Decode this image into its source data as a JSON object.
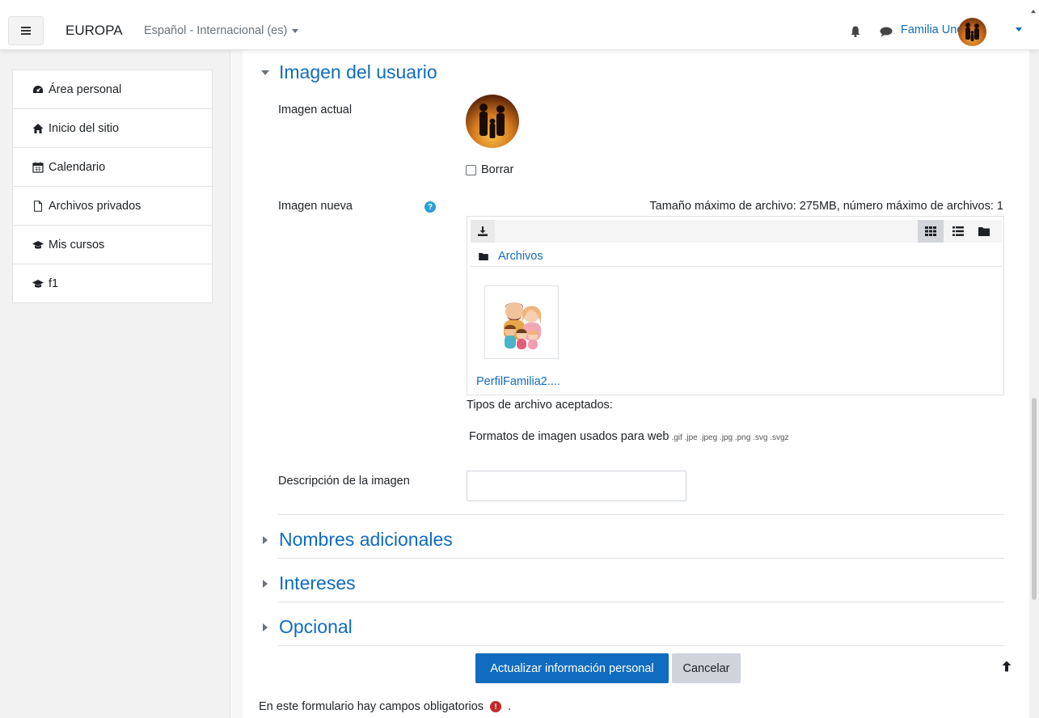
{
  "navbar": {
    "site_name": "EUROPA",
    "language": "Español - Internacional (es)",
    "user_name": "Familia Uno",
    "icons": [
      "hamburger-icon",
      "bell-icon",
      "chat-icon",
      "chevron-down-icon"
    ]
  },
  "sidebar": {
    "items": [
      {
        "label": "Área personal",
        "icon": "dashboard-icon"
      },
      {
        "label": "Inicio del sitio",
        "icon": "home-icon"
      },
      {
        "label": "Calendario",
        "icon": "calendar-icon"
      },
      {
        "label": "Archivos privados",
        "icon": "file-icon"
      },
      {
        "label": "Mis cursos",
        "icon": "graduation-cap-icon"
      },
      {
        "label": "f1",
        "icon": "graduation-cap-icon"
      }
    ]
  },
  "section_user_image": {
    "title": "Imagen del usuario",
    "current_image_label": "Imagen actual",
    "delete_label": "Borrar",
    "new_image_label": "Imagen nueva",
    "max_size_text": "Tamaño máximo de archivo: 275MB, número máximo de archivos: 1",
    "folder_label": "Archivos",
    "file_name": "PerfilFamilia2....",
    "accepted_types_label": "Tipos de archivo aceptados:",
    "formats_label": "Formatos de imagen usados para web",
    "formats_ext": ".gif .jpe .jpeg .jpg .png .svg .svgz",
    "description_label": "Descripción de la imagen",
    "description_value": ""
  },
  "collapsed_sections": [
    {
      "title": "Nombres adicionales"
    },
    {
      "title": "Intereses"
    },
    {
      "title": "Opcional"
    }
  ],
  "actions": {
    "submit_label": "Actualizar información personal",
    "cancel_label": "Cancelar"
  },
  "required_note": "En este formulario hay campos obligatorios",
  "required_note_suffix": ".",
  "colors": {
    "link": "#0f6cbf",
    "primary_button": "#0f6cbf",
    "secondary_button": "#ced4da",
    "help_icon": "#2a9fd6",
    "required_icon": "#c62828"
  }
}
